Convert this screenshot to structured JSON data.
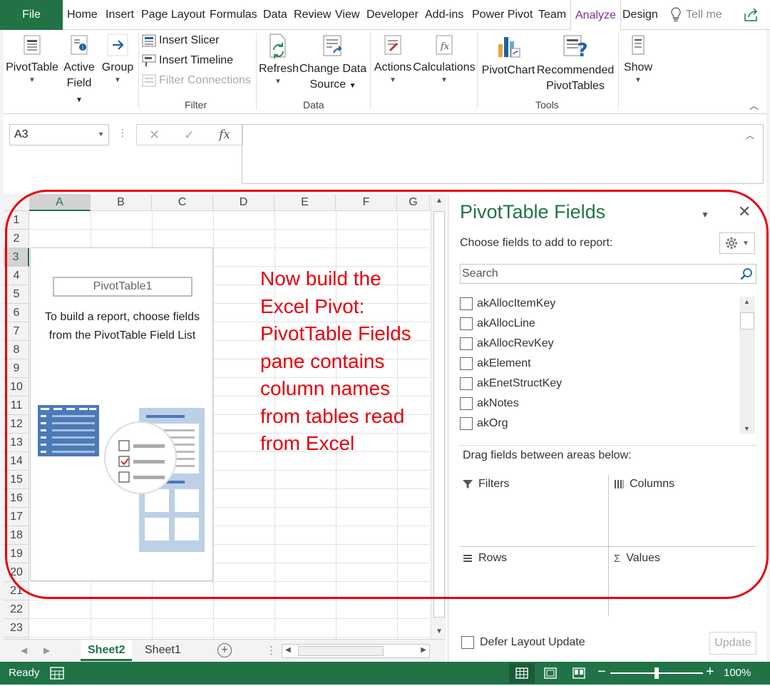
{
  "tabs": {
    "file": "File",
    "items": [
      "Home",
      "Insert",
      "Page Layout",
      "Formulas",
      "Data",
      "Review",
      "View",
      "Developer",
      "Add-ins",
      "Power Pivot",
      "Team",
      "Analyze",
      "Design"
    ],
    "tell_me": "Tell me",
    "active": "Analyze"
  },
  "ribbon": {
    "pivottable": "PivotTable",
    "active_field_1": "Active",
    "active_field_2": "Field",
    "group": "Group",
    "insert_slicer": "Insert Slicer",
    "insert_timeline": "Insert Timeline",
    "filter_connections": "Filter Connections",
    "filter_group": "Filter",
    "refresh": "Refresh",
    "change_data_1": "Change Data",
    "change_data_2": "Source",
    "data_group": "Data",
    "actions": "Actions",
    "calculations": "Calculations",
    "pivotchart": "PivotChart",
    "recommended_1": "Recommended",
    "recommended_2": "PivotTables",
    "tools_group": "Tools",
    "show": "Show",
    "accent": "#217346"
  },
  "formula_bar": {
    "name_box": "A3",
    "fx": "fx",
    "value": ""
  },
  "grid": {
    "columns": [
      "A",
      "B",
      "C",
      "D",
      "E",
      "F",
      "G"
    ],
    "rows": [
      "1",
      "2",
      "3",
      "4",
      "5",
      "6",
      "7",
      "8",
      "9",
      "10",
      "11",
      "12",
      "13",
      "14",
      "15",
      "16",
      "17",
      "18",
      "19",
      "20",
      "21",
      "22",
      "23"
    ],
    "selected_column": "A",
    "selected_row": "3"
  },
  "pivot_placeholder": {
    "name": "PivotTable1",
    "hint": "To build a report, choose fields from the PivotTable Field List"
  },
  "annotation": {
    "text": "Now build the\nExcel Pivot:\nPivotTable Fields\npane contains\ncolumn names\nfrom tables read\nfrom Excel",
    "color": "#e8000b"
  },
  "sheets": {
    "tabs": [
      "Sheet2",
      "Sheet1"
    ],
    "active": "Sheet2"
  },
  "fields_pane": {
    "title": "PivotTable Fields",
    "subtitle": "Choose fields to add to report:",
    "search_placeholder": "Search",
    "fields": [
      "akAllocItemKey",
      "akAllocLine",
      "akAllocRevKey",
      "akElement",
      "akEnetStructKey",
      "akNotes",
      "akOrg"
    ],
    "drag_label": "Drag fields between areas below:",
    "areas": {
      "filters": "Filters",
      "columns": "Columns",
      "rows": "Rows",
      "values": "Values"
    },
    "defer": "Defer Layout Update",
    "update": "Update"
  },
  "status": {
    "text": "Ready",
    "zoom": "100%",
    "zoom_fraction": 0.5
  }
}
